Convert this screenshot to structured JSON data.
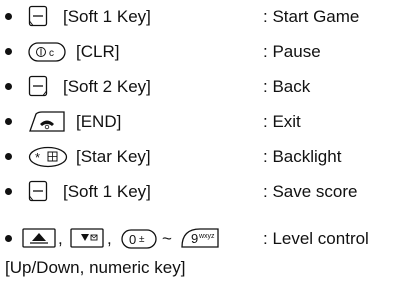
{
  "items": [
    {
      "key_icon": "soft-1-key-icon",
      "key_label": "[Soft 1 Key]",
      "action": ": Start Game"
    },
    {
      "key_icon": "clr-key-icon",
      "key_label": "[CLR]",
      "action": ": Pause"
    },
    {
      "key_icon": "soft-2-key-icon",
      "key_label": "[Soft 2 Key]",
      "action": ": Back"
    },
    {
      "key_icon": "end-key-icon",
      "key_label": "[END]",
      "action": ": Exit"
    },
    {
      "key_icon": "star-key-icon",
      "key_label": "[Star Key]",
      "action": ": Backlight"
    },
    {
      "key_icon": "soft-1-key-icon",
      "key_label": "[Soft 1 Key]",
      "action": ": Save score"
    },
    {
      "key_icon": "up-down-numeric-keys-icon",
      "key_label": "[Up/Down, numeric key]",
      "action": ": Level control",
      "separators": [
        ",",
        ",",
        "~"
      ]
    }
  ],
  "icon_glyphs": {
    "clr": "⓪ c",
    "star": "* ☼",
    "zero": "0 ±",
    "nine": "9 wxyz"
  }
}
